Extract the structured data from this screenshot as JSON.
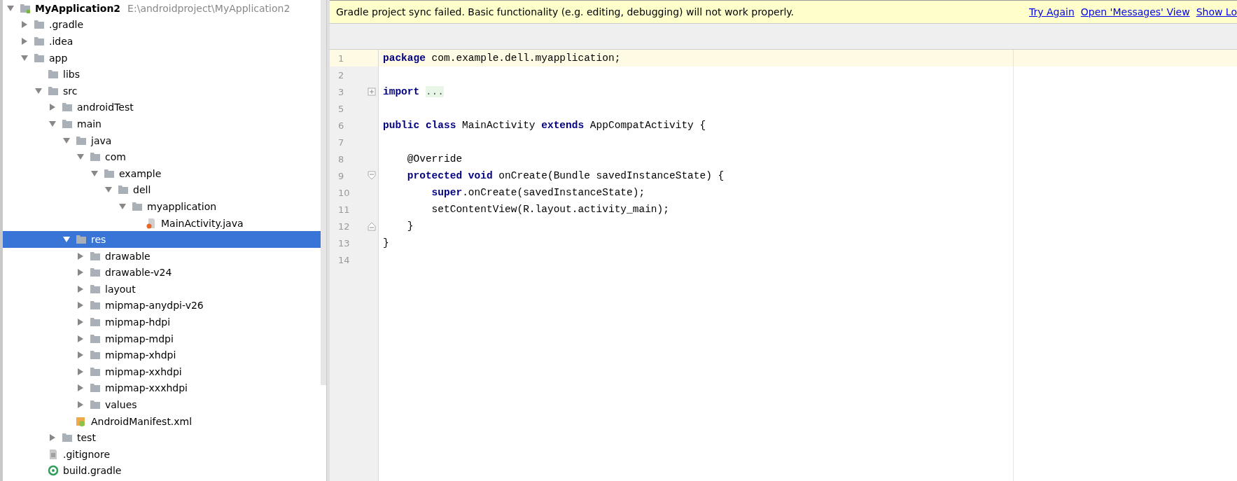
{
  "project_tree": {
    "items": [
      {
        "label": "MyApplication2",
        "kind": "module",
        "path": "E:\\androidproject\\MyApplication2",
        "expanded": true,
        "selected": false,
        "children": [
          {
            "label": ".gradle",
            "kind": "folder",
            "expanded": false,
            "selected": false
          },
          {
            "label": ".idea",
            "kind": "folder",
            "expanded": false,
            "selected": false
          },
          {
            "label": "app",
            "kind": "folder",
            "expanded": true,
            "selected": false,
            "children": [
              {
                "label": "libs",
                "kind": "folder",
                "selected": false
              },
              {
                "label": "src",
                "kind": "folder",
                "expanded": true,
                "selected": false,
                "children": [
                  {
                    "label": "androidTest",
                    "kind": "folder",
                    "expanded": false,
                    "selected": false
                  },
                  {
                    "label": "main",
                    "kind": "folder",
                    "expanded": true,
                    "selected": false,
                    "children": [
                      {
                        "label": "java",
                        "kind": "folder",
                        "expanded": true,
                        "selected": false,
                        "children": [
                          {
                            "label": "com",
                            "kind": "folder",
                            "expanded": true,
                            "selected": false,
                            "children": [
                              {
                                "label": "example",
                                "kind": "folder",
                                "expanded": true,
                                "selected": false,
                                "children": [
                                  {
                                    "label": "dell",
                                    "kind": "folder",
                                    "expanded": true,
                                    "selected": false,
                                    "children": [
                                      {
                                        "label": "myapplication",
                                        "kind": "folder",
                                        "expanded": true,
                                        "selected": false,
                                        "children": [
                                          {
                                            "label": "MainActivity.java",
                                            "kind": "java",
                                            "selected": false
                                          }
                                        ]
                                      }
                                    ]
                                  }
                                ]
                              }
                            ]
                          }
                        ]
                      },
                      {
                        "label": "res",
                        "kind": "folder",
                        "expanded": true,
                        "selected": true,
                        "children": [
                          {
                            "label": "drawable",
                            "kind": "folder",
                            "expanded": false,
                            "selected": false
                          },
                          {
                            "label": "drawable-v24",
                            "kind": "folder",
                            "expanded": false,
                            "selected": false
                          },
                          {
                            "label": "layout",
                            "kind": "folder",
                            "expanded": false,
                            "selected": false
                          },
                          {
                            "label": "mipmap-anydpi-v26",
                            "kind": "folder",
                            "expanded": false,
                            "selected": false
                          },
                          {
                            "label": "mipmap-hdpi",
                            "kind": "folder",
                            "expanded": false,
                            "selected": false
                          },
                          {
                            "label": "mipmap-mdpi",
                            "kind": "folder",
                            "expanded": false,
                            "selected": false
                          },
                          {
                            "label": "mipmap-xhdpi",
                            "kind": "folder",
                            "expanded": false,
                            "selected": false
                          },
                          {
                            "label": "mipmap-xxhdpi",
                            "kind": "folder",
                            "expanded": false,
                            "selected": false
                          },
                          {
                            "label": "mipmap-xxxhdpi",
                            "kind": "folder",
                            "expanded": false,
                            "selected": false
                          },
                          {
                            "label": "values",
                            "kind": "folder",
                            "expanded": false,
                            "selected": false
                          }
                        ]
                      },
                      {
                        "label": "AndroidManifest.xml",
                        "kind": "xml",
                        "selected": false
                      }
                    ]
                  },
                  {
                    "label": "test",
                    "kind": "folder",
                    "expanded": false,
                    "selected": false
                  }
                ]
              },
              {
                "label": ".gitignore",
                "kind": "text",
                "selected": false
              },
              {
                "label": "build.gradle",
                "kind": "gradle",
                "selected": false
              }
            ]
          }
        ]
      }
    ]
  },
  "notification": {
    "message": "Gradle project sync failed. Basic functionality (e.g. editing, debugging) will not work properly.",
    "links": [
      "Try Again",
      "Open 'Messages' View",
      "Show Lo"
    ]
  },
  "editor": {
    "lines": [
      {
        "number": "1",
        "current": true,
        "kind": "plain",
        "tokens": [
          {
            "kind": "keyword",
            "text": "package"
          },
          {
            "kind": "plain",
            "text": " com.example.dell.myapplication;"
          }
        ]
      },
      {
        "number": "2",
        "current": false,
        "kind": "plain"
      },
      {
        "number": "3",
        "current": false,
        "kind": "fold-collapsed",
        "tokens": [
          {
            "kind": "keyword",
            "text": "import "
          },
          {
            "kind": "folded",
            "text": "..."
          }
        ]
      },
      {
        "number": "5",
        "current": false,
        "kind": "plain"
      },
      {
        "number": "6",
        "current": false,
        "kind": "plain",
        "tokens": [
          {
            "kind": "keyword",
            "text": "public class"
          },
          {
            "kind": "plain",
            "text": " MainActivity "
          },
          {
            "kind": "keyword",
            "text": "extends"
          },
          {
            "kind": "plain",
            "text": " AppCompatActivity {"
          }
        ]
      },
      {
        "number": "7",
        "current": false,
        "kind": "plain"
      },
      {
        "number": "8",
        "current": false,
        "kind": "plain",
        "tokens": [
          {
            "kind": "plain",
            "text": "    @Override"
          }
        ]
      },
      {
        "number": "9",
        "current": false,
        "kind": "fold-start",
        "tokens": [
          {
            "kind": "keyword",
            "text": "    protected void"
          },
          {
            "kind": "plain",
            "text": " onCreate(Bundle savedInstanceState) {"
          }
        ]
      },
      {
        "number": "10",
        "current": false,
        "kind": "plain",
        "tokens": [
          {
            "kind": "keyword",
            "text": "        super"
          },
          {
            "kind": "plain",
            "text": ".onCreate(savedInstanceState);"
          }
        ]
      },
      {
        "number": "11",
        "current": false,
        "kind": "plain",
        "tokens": [
          {
            "kind": "plain",
            "text": "        setContentView(R.layout.activity_main);"
          }
        ]
      },
      {
        "number": "12",
        "current": false,
        "kind": "fold-end",
        "tokens": [
          {
            "kind": "plain",
            "text": "    }"
          }
        ]
      },
      {
        "number": "13",
        "current": false,
        "kind": "plain",
        "tokens": [
          {
            "kind": "plain",
            "text": "}"
          }
        ]
      },
      {
        "number": "14",
        "current": false,
        "kind": "plain"
      }
    ]
  }
}
